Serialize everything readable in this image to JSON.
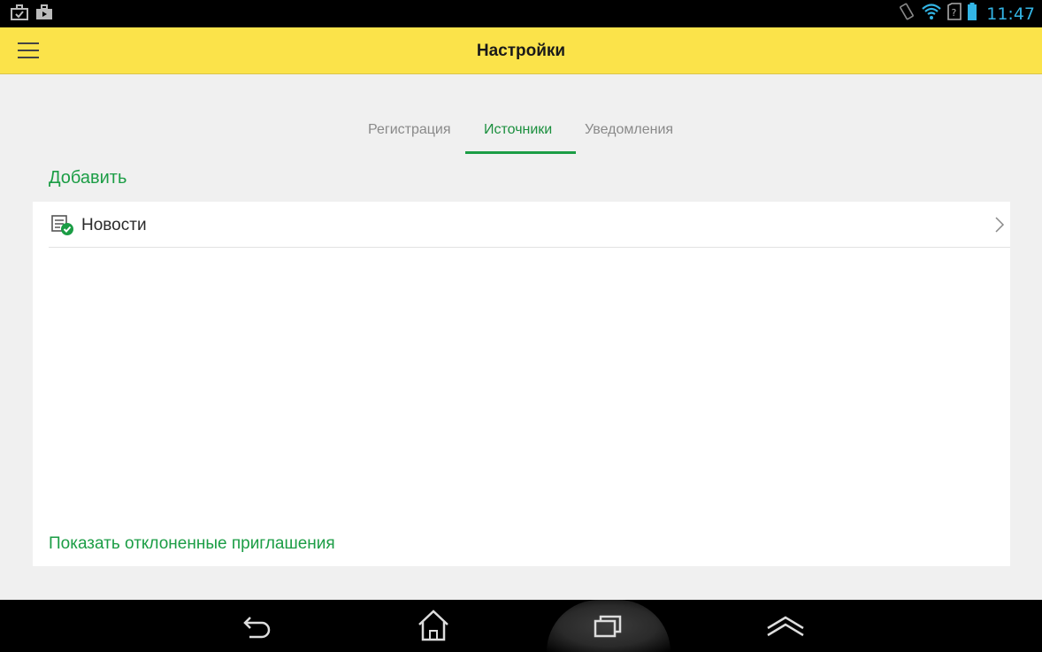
{
  "status_bar": {
    "clock": "11:47",
    "left_icons": [
      "briefcase-check-icon",
      "briefcase-play-icon"
    ],
    "right_icons": [
      "screen-rotation-icon",
      "wifi-icon",
      "no-sim-icon",
      "battery-icon"
    ],
    "accent_color": "#33b5e5"
  },
  "appbar": {
    "title": "Настройки",
    "background": "#fbe34a"
  },
  "tabs": [
    {
      "label": "Регистрация",
      "active": false
    },
    {
      "label": "Источники",
      "active": true
    },
    {
      "label": "Уведомления",
      "active": false
    }
  ],
  "add_label": "Добавить",
  "sources": [
    {
      "label": "Новости",
      "icon": "news-verified-icon"
    }
  ],
  "show_declined_label": "Показать отклоненные приглашения",
  "accent_color": "#1b9d45",
  "navigation": [
    "back-icon",
    "home-icon",
    "recent-apps-icon",
    "menu-up-icon"
  ]
}
